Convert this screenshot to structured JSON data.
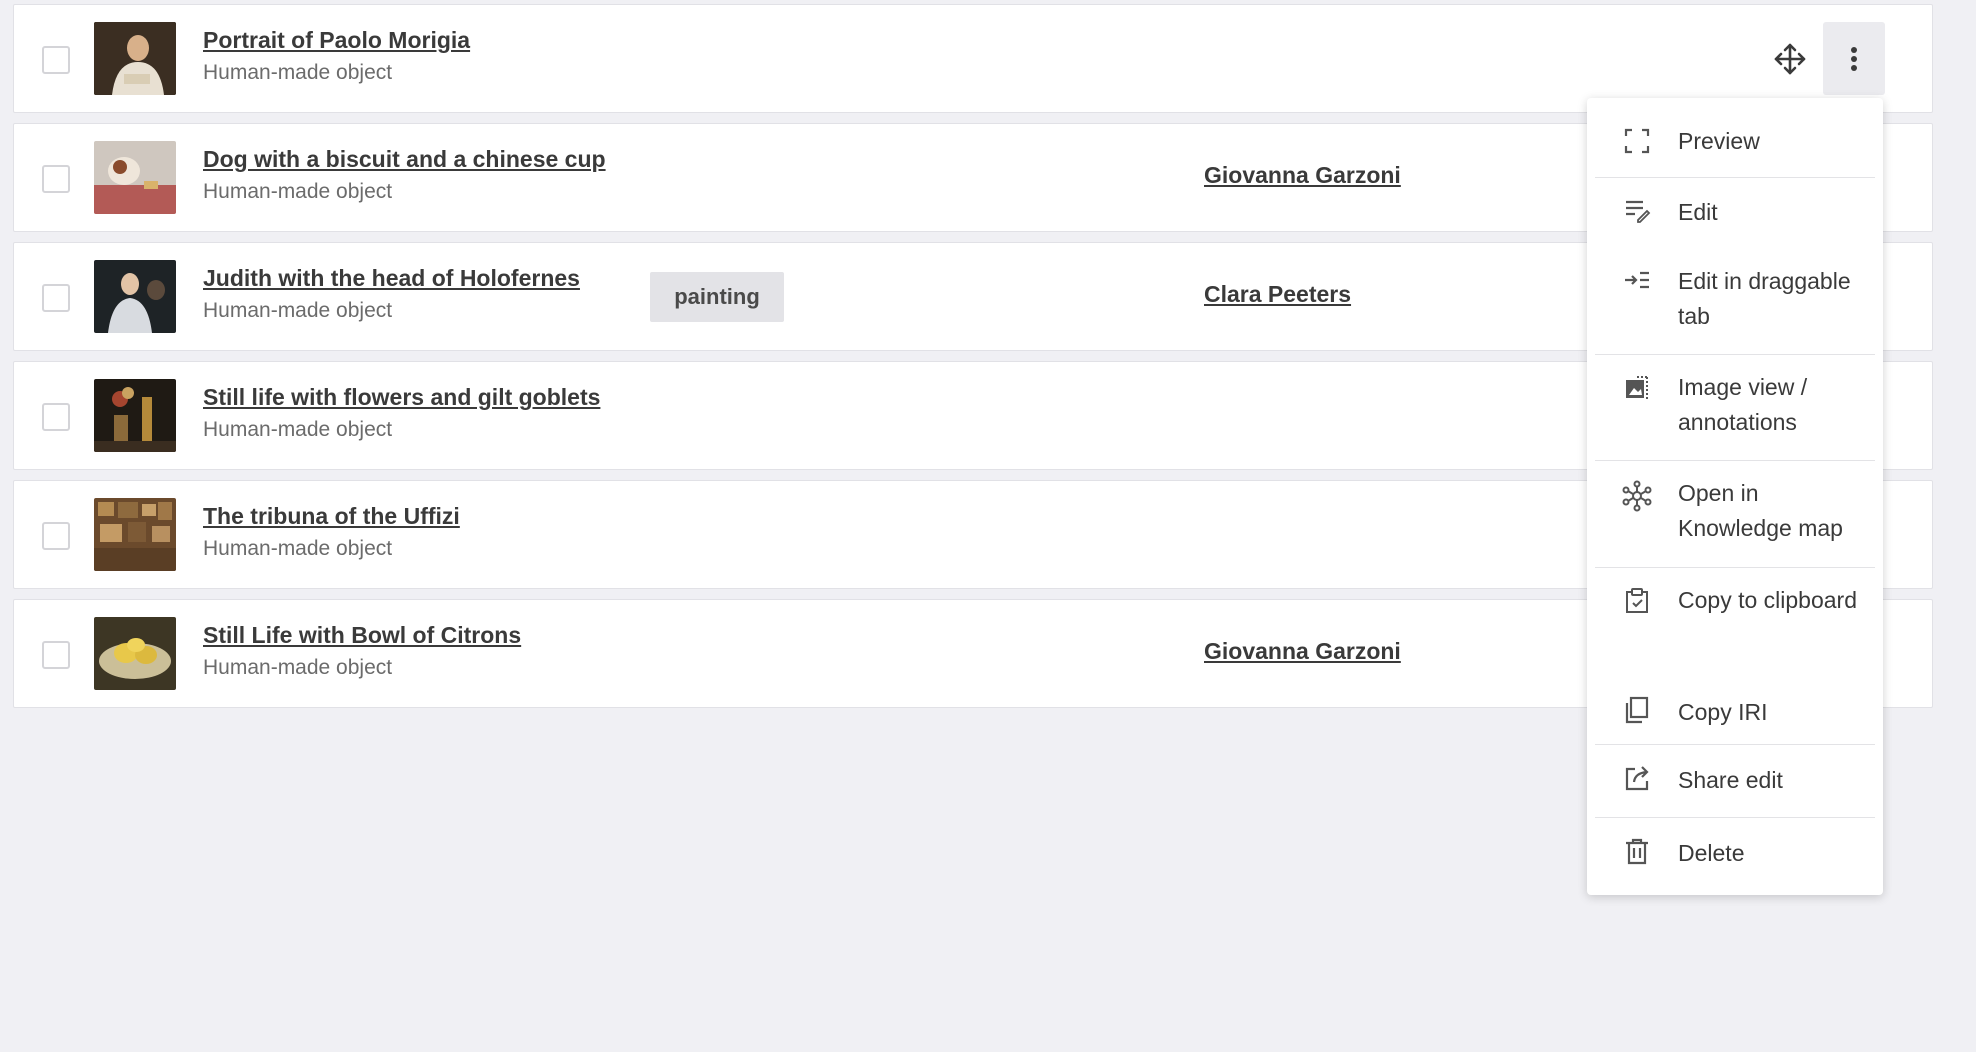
{
  "rows": [
    {
      "title": "Portrait of Paolo Morigia",
      "subtitle": "Human-made object",
      "tag": "",
      "creator": ""
    },
    {
      "title": "Dog with a biscuit and a chinese cup",
      "subtitle": "Human-made object",
      "tag": "",
      "creator": "Giovanna Garzoni"
    },
    {
      "title": "Judith with the head of Holofernes",
      "subtitle": "Human-made object",
      "tag": "painting",
      "creator": "Clara Peeters"
    },
    {
      "title": "Still life with flowers and gilt goblets",
      "subtitle": "Human-made object",
      "tag": "",
      "creator": ""
    },
    {
      "title": "The tribuna of the Uffizi",
      "subtitle": "Human-made object",
      "tag": "",
      "creator": ""
    },
    {
      "title": "Still Life with Bowl of Citrons",
      "subtitle": "Human-made object",
      "tag": "",
      "creator": "Giovanna Garzoni"
    }
  ],
  "row_actions": {
    "move_icon": "move-arrows-icon",
    "menu_icon": "kebab-vertical-icon"
  },
  "context_menu": {
    "items": [
      {
        "label": "Preview",
        "icon": "fullscreen-corners-icon"
      },
      {
        "label": "Edit",
        "icon": "edit-lines-icon"
      },
      {
        "label": "Edit in draggable tab",
        "icon": "arrow-into-list-icon"
      },
      {
        "label": "Image view / annotations",
        "icon": "image-annotation-icon"
      },
      {
        "label": "Open in Knowledge map",
        "icon": "graph-network-icon"
      },
      {
        "label": "Copy to clipboard",
        "icon": "clipboard-check-icon"
      },
      {
        "label": "Copy IRI",
        "icon": "copy-pages-icon"
      },
      {
        "label": "Share edit",
        "icon": "share-box-icon"
      },
      {
        "label": "Delete",
        "icon": "trash-icon"
      }
    ]
  },
  "colors": {
    "background": "#f0f0f4",
    "row_background": "#ffffff",
    "text": "#3a3a3a",
    "muted_text": "#6b6b6b"
  }
}
